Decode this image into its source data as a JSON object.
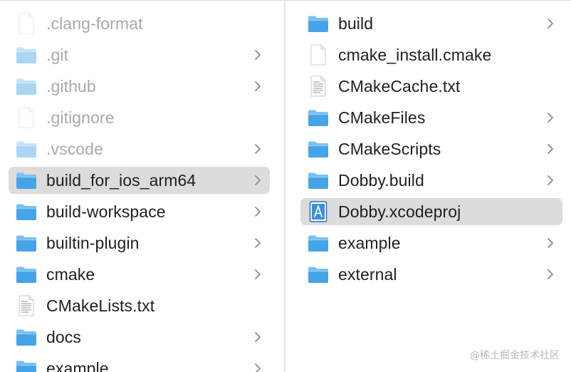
{
  "left_column": {
    "items": [
      {
        "label": ".clang-format",
        "icon": "file-icon",
        "has_chevron": false,
        "dimmed": true,
        "selected": false
      },
      {
        "label": ".git",
        "icon": "folder-icon",
        "has_chevron": true,
        "dimmed": true,
        "selected": false
      },
      {
        "label": ".github",
        "icon": "folder-icon",
        "has_chevron": true,
        "dimmed": true,
        "selected": false
      },
      {
        "label": ".gitignore",
        "icon": "file-icon",
        "has_chevron": false,
        "dimmed": true,
        "selected": false
      },
      {
        "label": ".vscode",
        "icon": "folder-icon",
        "has_chevron": true,
        "dimmed": true,
        "selected": false
      },
      {
        "label": "build_for_ios_arm64",
        "icon": "folder-icon",
        "has_chevron": true,
        "dimmed": false,
        "selected": true
      },
      {
        "label": "build-workspace",
        "icon": "folder-icon",
        "has_chevron": true,
        "dimmed": false,
        "selected": false
      },
      {
        "label": "builtin-plugin",
        "icon": "folder-icon",
        "has_chevron": true,
        "dimmed": false,
        "selected": false
      },
      {
        "label": "cmake",
        "icon": "folder-icon",
        "has_chevron": true,
        "dimmed": false,
        "selected": false
      },
      {
        "label": "CMakeLists.txt",
        "icon": "text-file-icon",
        "has_chevron": false,
        "dimmed": false,
        "selected": false
      },
      {
        "label": "docs",
        "icon": "folder-icon",
        "has_chevron": true,
        "dimmed": false,
        "selected": false
      },
      {
        "label": "example",
        "icon": "folder-icon",
        "has_chevron": true,
        "dimmed": false,
        "selected": false
      }
    ]
  },
  "right_column": {
    "items": [
      {
        "label": "build",
        "icon": "folder-icon",
        "has_chevron": true,
        "dimmed": false,
        "selected": false
      },
      {
        "label": "cmake_install.cmake",
        "icon": "file-icon",
        "has_chevron": false,
        "dimmed": false,
        "selected": false
      },
      {
        "label": "CMakeCache.txt",
        "icon": "text-file-icon",
        "has_chevron": false,
        "dimmed": false,
        "selected": false
      },
      {
        "label": "CMakeFiles",
        "icon": "folder-icon",
        "has_chevron": true,
        "dimmed": false,
        "selected": false
      },
      {
        "label": "CMakeScripts",
        "icon": "folder-icon",
        "has_chevron": true,
        "dimmed": false,
        "selected": false
      },
      {
        "label": "Dobby.build",
        "icon": "folder-icon",
        "has_chevron": true,
        "dimmed": false,
        "selected": false
      },
      {
        "label": "Dobby.xcodeproj",
        "icon": "xcodeproj-icon",
        "has_chevron": false,
        "dimmed": false,
        "selected": true
      },
      {
        "label": "example",
        "icon": "folder-icon",
        "has_chevron": true,
        "dimmed": false,
        "selected": false
      },
      {
        "label": "external",
        "icon": "folder-icon",
        "has_chevron": true,
        "dimmed": false,
        "selected": false
      }
    ]
  },
  "colors": {
    "folder_front": "#4aa6e8",
    "folder_back": "#76bff1",
    "selection": "#dcdcdc",
    "dimmed_text": "#a9a9a9",
    "text": "#1f1f1f"
  },
  "watermark": "@稀土掘金技术社区"
}
